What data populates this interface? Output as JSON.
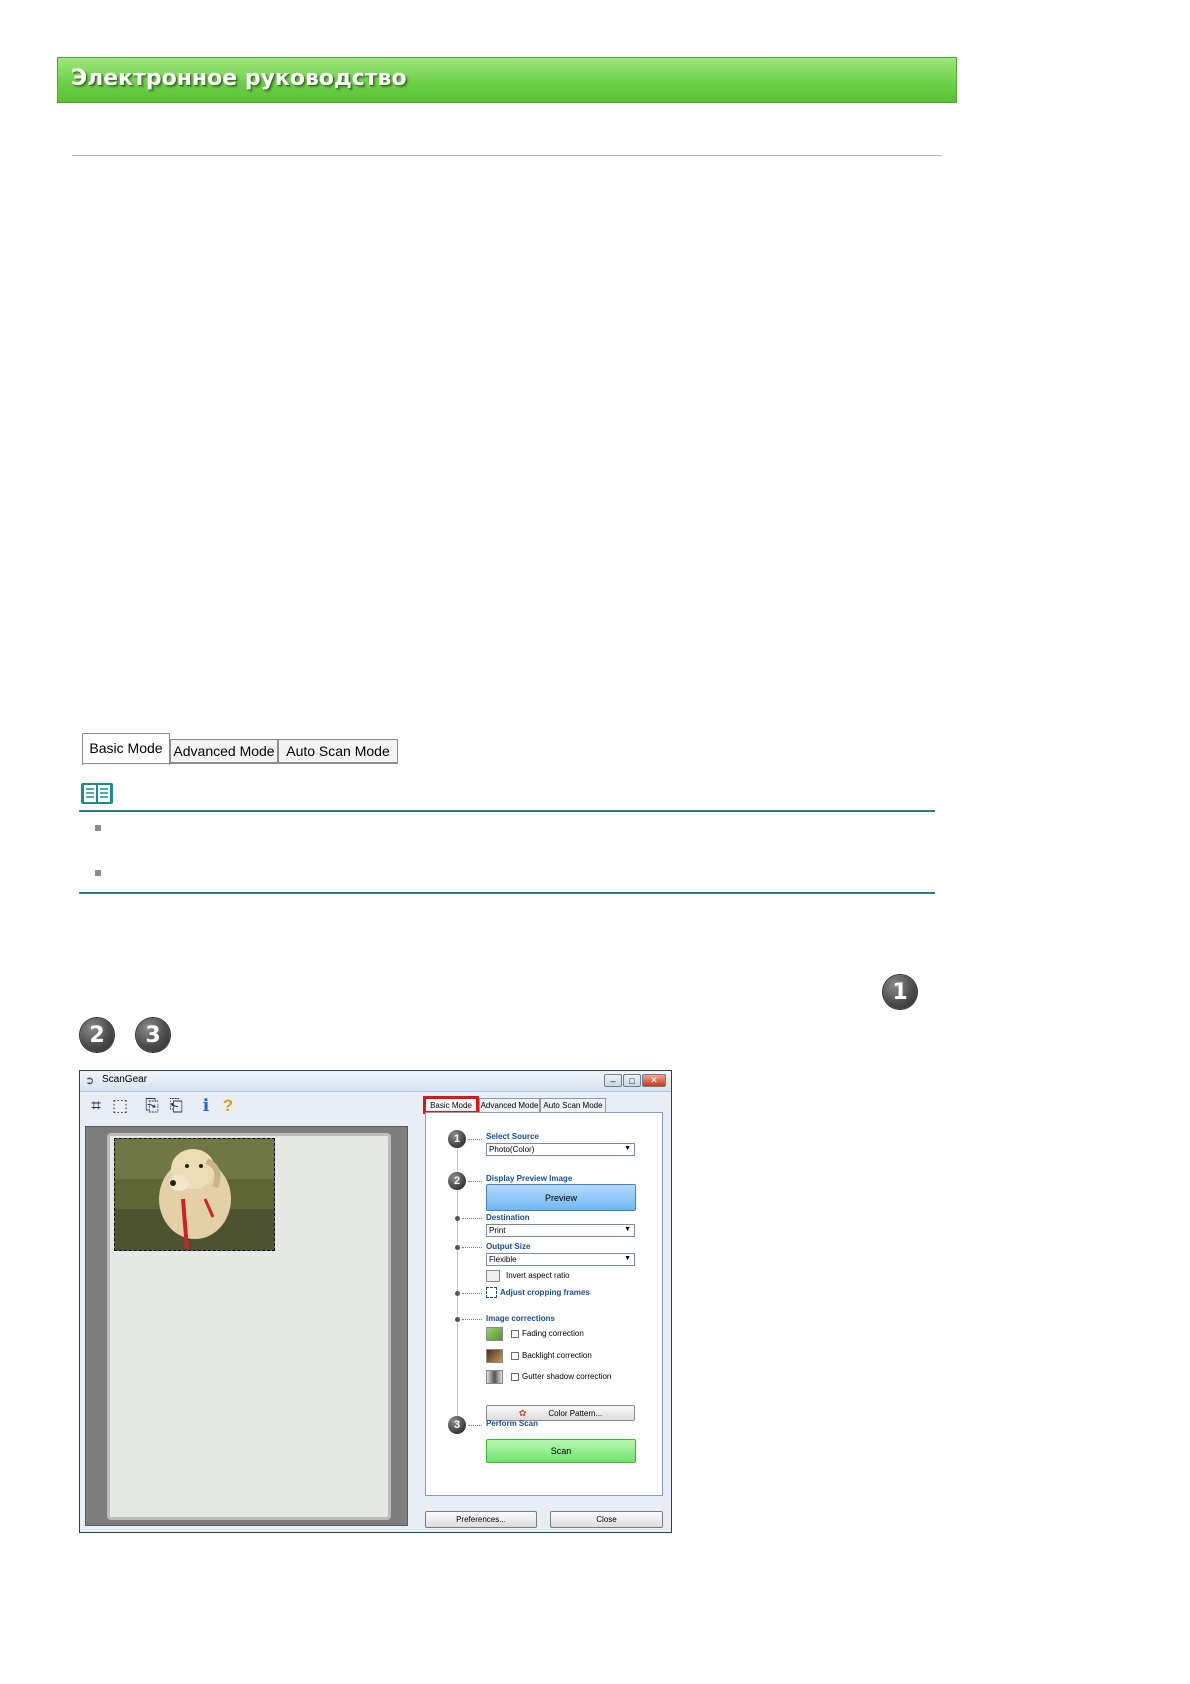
{
  "header": {
    "title": "Электронное руководство"
  },
  "mode_tabs": [
    "Basic Mode",
    "Advanced Mode",
    "Auto Scan Mode"
  ],
  "step_numbers": [
    "1",
    "2",
    "3"
  ],
  "scangear": {
    "title": "ScanGear",
    "tabs": [
      "Basic Mode",
      "Advanced Mode",
      "Auto Scan Mode"
    ],
    "select_source": {
      "label": "Select Source",
      "value": "Photo(Color)"
    },
    "display_preview": {
      "label": "Display Preview Image",
      "button": "Preview"
    },
    "destination": {
      "label": "Destination",
      "value": "Print"
    },
    "output_size": {
      "label": "Output Size",
      "value": "Flexible",
      "invert": "Invert aspect ratio"
    },
    "adjust_cropping": "Adjust cropping frames",
    "image_corrections": {
      "label": "Image corrections",
      "items": [
        "Fading correction",
        "Backlight correction",
        "Gutter shadow correction"
      ]
    },
    "color_pattern_button": "Color Pattern...",
    "perform_scan": {
      "label": "Perform Scan",
      "button": "Scan"
    },
    "preferences_button": "Preferences...",
    "close_button": "Close"
  }
}
